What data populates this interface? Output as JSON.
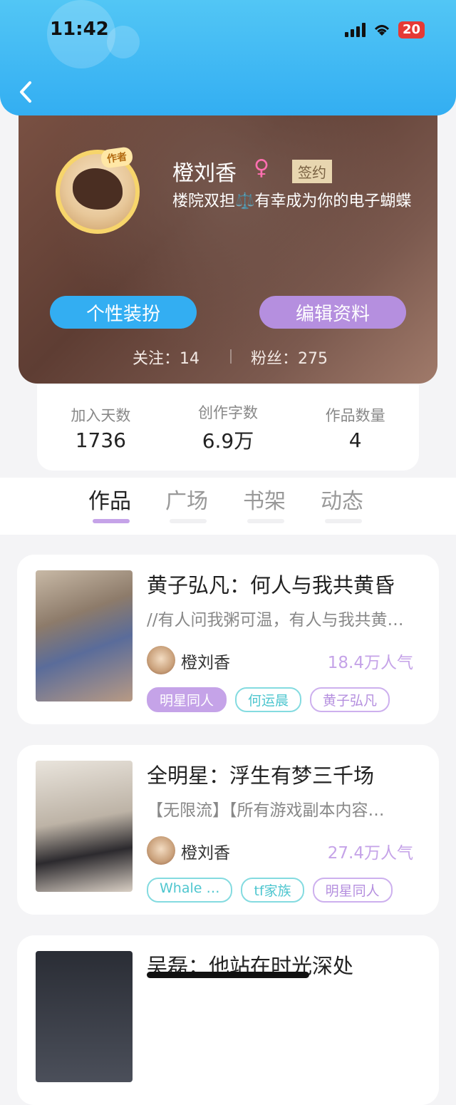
{
  "status_bar": {
    "time": "11:42",
    "battery": "20"
  },
  "profile": {
    "author_badge": "作者",
    "name": "橙刘香",
    "gender_symbol": "♀",
    "badge": "签约",
    "bio": "楼院双担⚖️有幸成为你的电子蝴蝶",
    "buttons": {
      "dress": "个性装扮",
      "edit": "编辑资料"
    },
    "follow": "关注：14",
    "fans": "粉丝：275"
  },
  "stats": [
    {
      "label": "加入天数",
      "value": "1736"
    },
    {
      "label": "创作字数",
      "value": "6.9万"
    },
    {
      "label": "作品数量",
      "value": "4"
    }
  ],
  "tabs": [
    "作品",
    "广场",
    "书架",
    "动态"
  ],
  "active_tab": 0,
  "books": [
    {
      "title": "黄子弘凡：何人与我共黄昏",
      "desc": "//有人问我粥可温，有人与我共黄…",
      "author": "橙刘香",
      "popularity": "18.4万人气",
      "tags": [
        {
          "label": "明星同人",
          "style": "fill"
        },
        {
          "label": "何运晨",
          "style": "teal"
        },
        {
          "label": "黄子弘凡",
          "style": "purple"
        }
      ]
    },
    {
      "title": "全明星：浮生有梦三千场",
      "desc": "【无限流】【所有游戏副本内容…",
      "author": "橙刘香",
      "popularity": "27.4万人气",
      "tags": [
        {
          "label": "Whale …",
          "style": "teal"
        },
        {
          "label": "tf家族",
          "style": "teal"
        },
        {
          "label": "明星同人",
          "style": "purple"
        }
      ]
    },
    {
      "title": "吴磊：他站在时光深处"
    }
  ],
  "colors": {
    "header": "#33aef2",
    "accent_purple": "#b58fdf",
    "accent_teal": "#4ec6cf"
  }
}
